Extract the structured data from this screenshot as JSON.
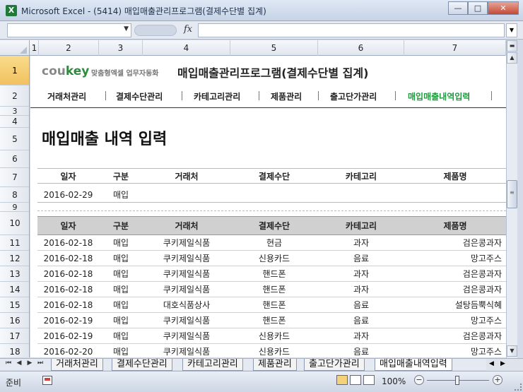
{
  "window": {
    "title": "Microsoft Excel - (5414) 매입매출관리프로그램(결제수단별 집계)",
    "app_icon": "X",
    "minimize": "—",
    "maximize": "□",
    "close": "✕"
  },
  "formula_bar": {
    "name_box": "",
    "fx": "fx",
    "formula": ""
  },
  "columns": [
    "1",
    "2",
    "3",
    "4",
    "5",
    "6",
    "7"
  ],
  "rows": [
    "1",
    "2",
    "3",
    "4",
    "5",
    "6",
    "7",
    "8",
    "9",
    "10",
    "11",
    "12",
    "13",
    "14",
    "15",
    "16",
    "17",
    "18"
  ],
  "brand": {
    "logo_prefix": "cou",
    "logo_suffix": "key",
    "tagline": "맞춤형엑셀 업무자동화",
    "program_title": "매입매출관리프로그램(결제수단별 집계)"
  },
  "nav": {
    "items": [
      "거래처관리",
      "결제수단관리",
      "카테고리관리",
      "제품관리",
      "출고단가관리",
      "매입매출내역입력"
    ],
    "active_index": 5
  },
  "page_heading": "매입매출 내역 입력",
  "table": {
    "headers": [
      "일자",
      "구분",
      "거래처",
      "결제수단",
      "카테고리",
      "제품명"
    ],
    "input_row": [
      "2016-02-29",
      "매입",
      "",
      "",
      "",
      ""
    ],
    "rows": [
      [
        "2016-02-18",
        "매입",
        "쿠키제일식품",
        "현금",
        "과자",
        "검은콩과자"
      ],
      [
        "2016-02-18",
        "매입",
        "쿠키제일식품",
        "신용카드",
        "음료",
        "망고주스"
      ],
      [
        "2016-02-18",
        "매입",
        "쿠키제일식품",
        "핸드폰",
        "과자",
        "검은콩과자"
      ],
      [
        "2016-02-18",
        "매입",
        "쿠키제일식품",
        "핸드폰",
        "과자",
        "검은콩과자"
      ],
      [
        "2016-02-18",
        "매입",
        "대호식품상사",
        "핸드폰",
        "음료",
        "설탕듬뿍식혜"
      ],
      [
        "2016-02-19",
        "매입",
        "쿠키제일식품",
        "핸드폰",
        "음료",
        "망고주스"
      ],
      [
        "2016-02-19",
        "매입",
        "쿠키제일식품",
        "신용카드",
        "과자",
        "검은콩과자"
      ],
      [
        "2016-02-20",
        "매입",
        "쿠키제일식품",
        "신용카드",
        "음료",
        "망고주스"
      ]
    ]
  },
  "sheet_tabs": {
    "items": [
      "거래처관리",
      "결제수단관리",
      "카테고리관리",
      "제품관리",
      "출고단가관리",
      "매입매출내역입력"
    ],
    "active_index": 5
  },
  "status": {
    "ready": "준비",
    "zoom": "100%",
    "zoom_minus": "−",
    "zoom_plus": "+"
  },
  "colors": {
    "brand_green": "#2e8b3e",
    "nav_active": "#1f9a3e",
    "header_gray": "#d0d0d0"
  }
}
